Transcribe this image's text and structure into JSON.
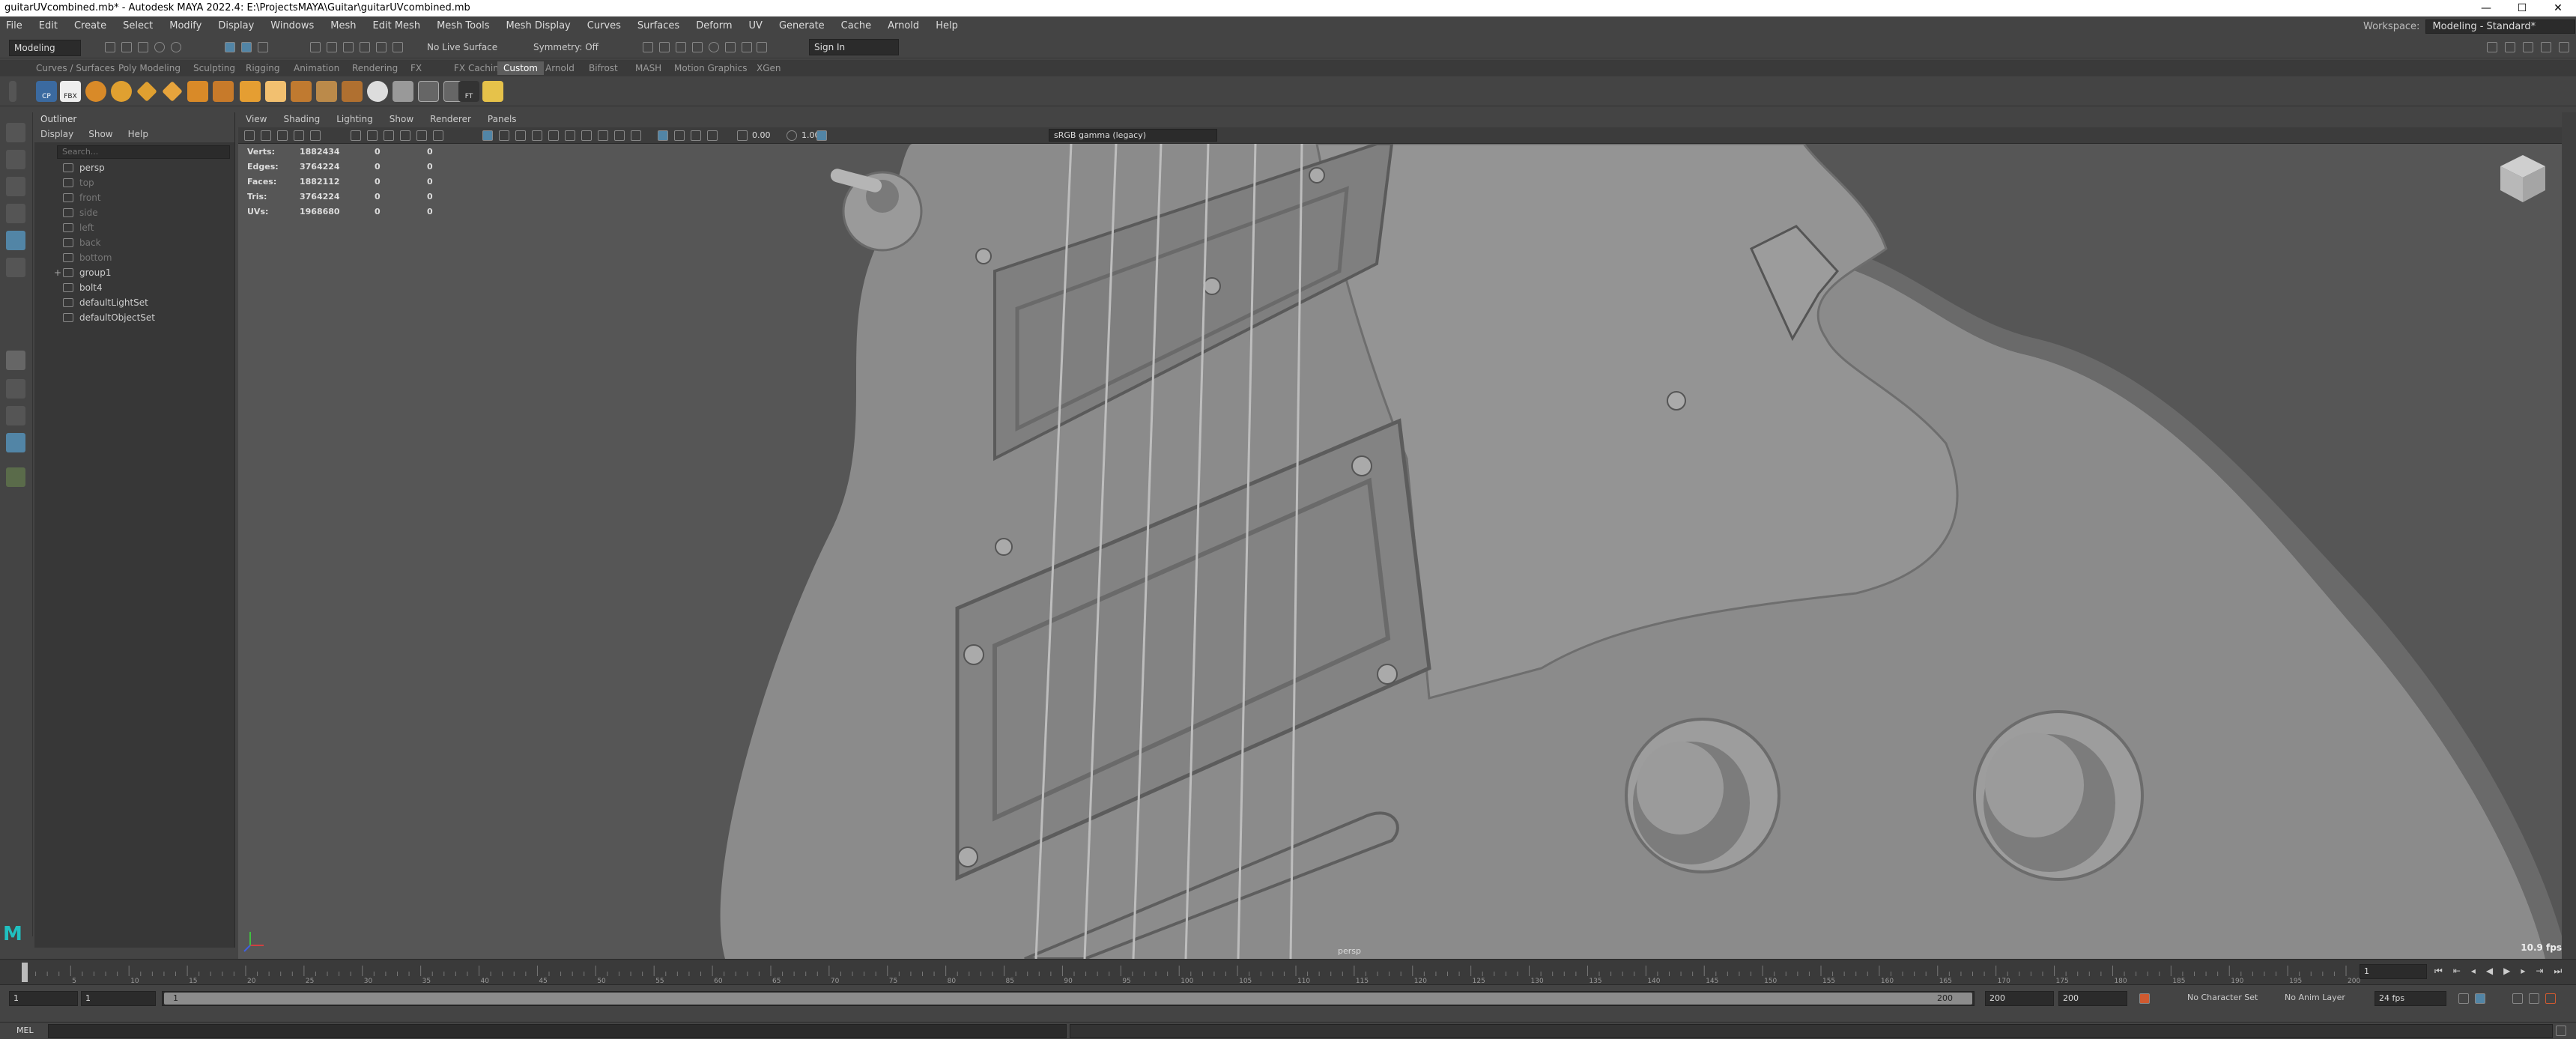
{
  "window": {
    "title": "guitarUVcombined.mb* - Autodesk MAYA 2022.4: E:\\ProjectsMAYA\\Guitar\\guitarUVcombined.mb",
    "minimize": "—",
    "maximize": "☐",
    "close": "✕"
  },
  "menubar": {
    "items": [
      "File",
      "Edit",
      "Create",
      "Select",
      "Modify",
      "Display",
      "Windows",
      "Mesh",
      "Edit Mesh",
      "Mesh Tools",
      "Mesh Display",
      "Curves",
      "Surfaces",
      "Deform",
      "UV",
      "Generate",
      "Cache",
      "Arnold",
      "Help"
    ],
    "workspace_label": "Workspace:",
    "workspace_value": "Modeling - Standard*"
  },
  "statusline": {
    "mode": "Modeling",
    "live_surface": "No Live Surface",
    "symmetry": "Symmetry: Off",
    "sign_in": "Sign In"
  },
  "shelf": {
    "tabs": [
      "Curves / Surfaces",
      "Poly Modeling",
      "Sculpting",
      "Rigging",
      "Animation",
      "Rendering",
      "FX",
      "FX Caching",
      "Custom",
      "Arnold",
      "Bifrost",
      "MASH",
      "Motion Graphics",
      "XGen"
    ],
    "active_tab": "Custom",
    "icon_labels": {
      "cp": "CP",
      "fbx": "FBX",
      "ft": "FT"
    }
  },
  "outliner": {
    "title": "Outliner",
    "menu": [
      "Display",
      "Show",
      "Help"
    ],
    "search_placeholder": "Search...",
    "items": [
      {
        "label": "persp",
        "dim": false,
        "expander": ""
      },
      {
        "label": "top",
        "dim": true,
        "expander": ""
      },
      {
        "label": "front",
        "dim": true,
        "expander": ""
      },
      {
        "label": "side",
        "dim": true,
        "expander": ""
      },
      {
        "label": "left",
        "dim": true,
        "expander": ""
      },
      {
        "label": "back",
        "dim": true,
        "expander": ""
      },
      {
        "label": "bottom",
        "dim": true,
        "expander": ""
      },
      {
        "label": "group1",
        "dim": false,
        "expander": "+"
      },
      {
        "label": "bolt4",
        "dim": false,
        "expander": ""
      },
      {
        "label": "defaultLightSet",
        "dim": false,
        "expander": ""
      },
      {
        "label": "defaultObjectSet",
        "dim": false,
        "expander": ""
      }
    ]
  },
  "panel": {
    "menu": [
      "View",
      "Shading",
      "Lighting",
      "Show",
      "Renderer",
      "Panels"
    ],
    "exposure": "0.00",
    "gamma": "1.00",
    "color_management": "sRGB gamma (legacy)"
  },
  "hud": {
    "rows": [
      {
        "label": "Verts:",
        "value": "1882434",
        "sel": "0",
        "comp": "0"
      },
      {
        "label": "Edges:",
        "value": "3764224",
        "sel": "0",
        "comp": "0"
      },
      {
        "label": "Faces:",
        "value": "1882112",
        "sel": "0",
        "comp": "0"
      },
      {
        "label": "Tris:",
        "value": "3764224",
        "sel": "0",
        "comp": "0"
      },
      {
        "label": "UVs:",
        "value": "1968680",
        "sel": "0",
        "comp": "0"
      }
    ],
    "fps": "10.9 fps",
    "camera": "persp"
  },
  "timeslider": {
    "start": 1,
    "end": 200,
    "current_frame": "1",
    "tick_step": 5
  },
  "rangeslider": {
    "start_field": "1",
    "start_inner": "1",
    "range_start_label": "1",
    "range_end_label": "200",
    "end_inner": "200",
    "end_field": "200",
    "character_set": "No Character Set",
    "anim_layer": "No Anim Layer",
    "fps": "24 fps"
  },
  "cmdline": {
    "language": "MEL"
  },
  "colors": {
    "ui_bg": "#444444",
    "panel_dark": "#373737",
    "viewport_bg": "#555555",
    "guitar_body": "#8a8a8a",
    "accent_blue": "#5285a6"
  }
}
